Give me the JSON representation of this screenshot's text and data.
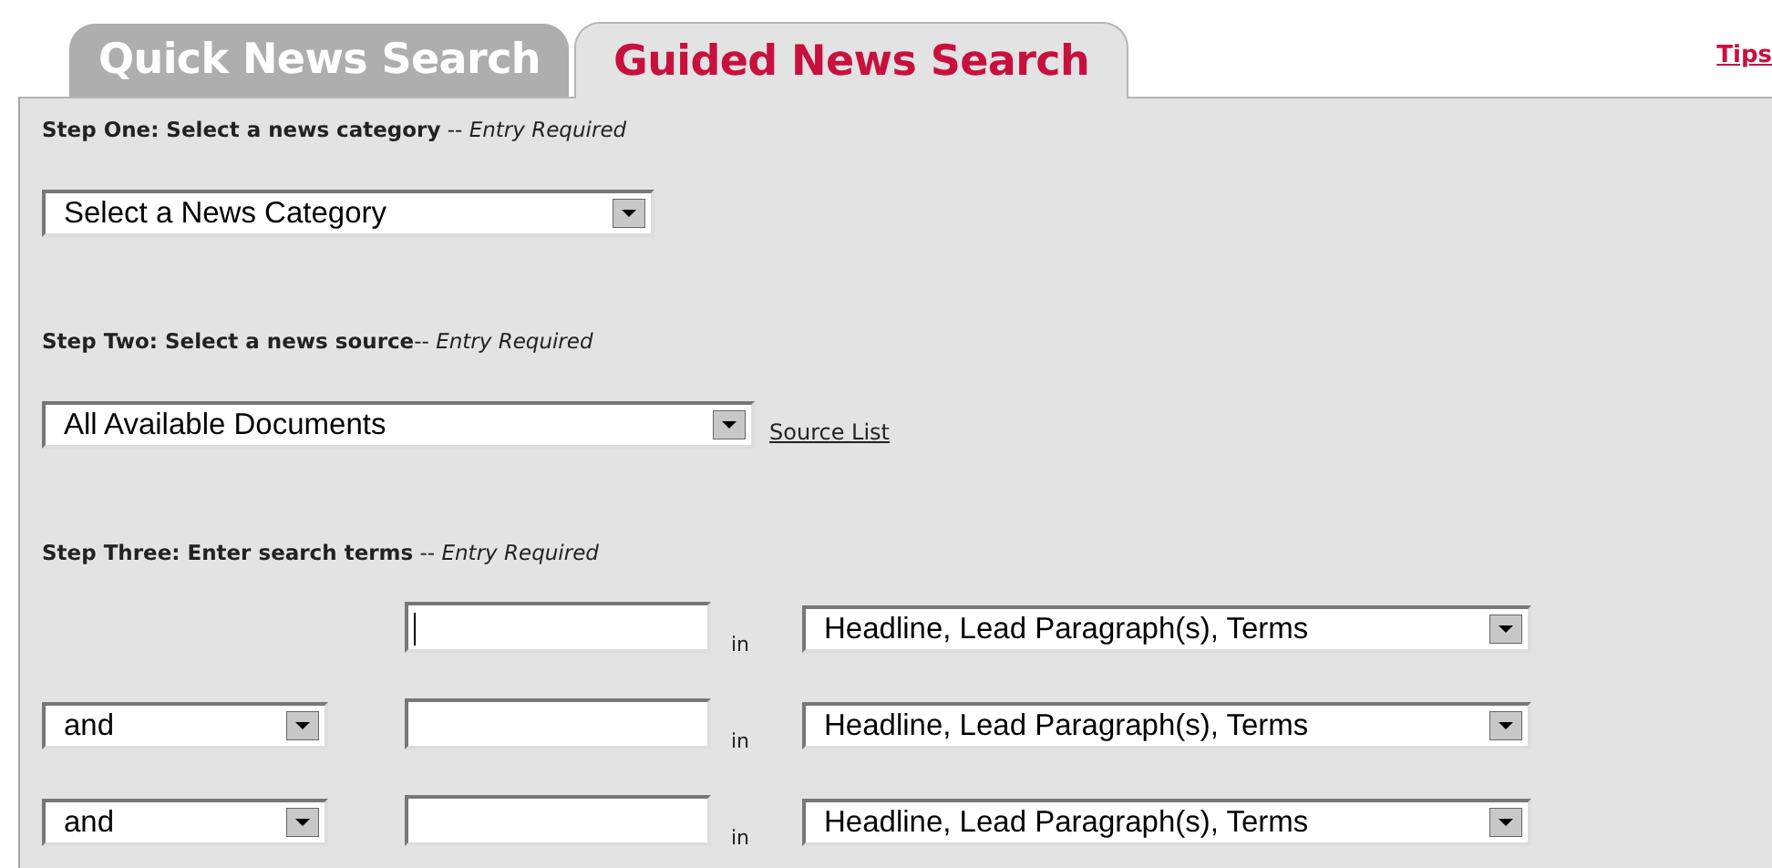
{
  "tabs": [
    {
      "label": "Quick News Search",
      "selected": false
    },
    {
      "label": "Guided News Search",
      "selected": true
    }
  ],
  "tips_link": "Tips",
  "steps": [
    {
      "heading": "**Step One: Select a news category** -- *Entry Required*",
      "select": "Select a News Category"
    },
    {
      "heading": "**Step Two: Select a news source**-- *Entry Required*",
      "select": "All Available Documents",
      "link": "Source List"
    },
    {
      "heading": "**Step Three: Enter search terms** -- *Entry Required*"
    }
  ],
  "search_rows": [
    {
      "focused": true,
      "in_label": "in",
      "field": "Headline, Lead Paragraph(s), Terms"
    },
    {
      "connector": "and",
      "focused": false,
      "in_label": "in",
      "field": "Headline, Lead Paragraph(s), Terms"
    },
    {
      "connector": "and",
      "focused": false,
      "in_label": "in",
      "field": "Headline, Lead Paragraph(s), Terms"
    }
  ]
}
